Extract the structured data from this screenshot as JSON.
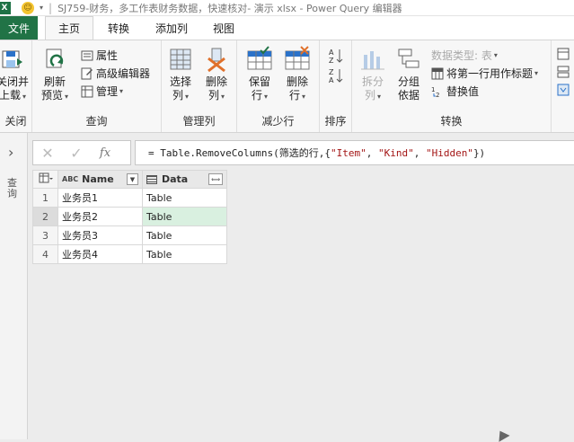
{
  "titlebar": {
    "app_icon": "X",
    "title": "SJ759-财务，多工作表财务数据，快速核对- 演示 xlsx - Power Query 编辑器"
  },
  "tabs": [
    {
      "label": "文件"
    },
    {
      "label": "主页"
    },
    {
      "label": "转换"
    },
    {
      "label": "添加列"
    },
    {
      "label": "视图"
    }
  ],
  "ribbon": {
    "close": {
      "btn_line1": "关闭并",
      "btn_line2": "上载",
      "group": "关闭"
    },
    "query": {
      "refresh_line1": "刷新",
      "refresh_line2": "预览",
      "properties": "属性",
      "advanced_editor": "高级编辑器",
      "manage": "管理",
      "group": "查询"
    },
    "manage_cols": {
      "choose_line1": "选择",
      "choose_line2": "列",
      "remove_line1": "删除",
      "remove_line2": "列",
      "group": "管理列"
    },
    "reduce_rows": {
      "keep_line1": "保留",
      "keep_line2": "行",
      "remove_line1": "删除",
      "remove_line2": "行",
      "group": "减少行"
    },
    "sort": {
      "group": "排序"
    },
    "transform": {
      "split_line1": "拆分",
      "split_line2": "列",
      "group_line1": "分组",
      "group_line2": "依据",
      "datatype": "数据类型: 表",
      "first_row_header": "将第一行用作标题",
      "replace_values": "替换值",
      "group": "转换"
    }
  },
  "leftnav": {
    "label": "查询"
  },
  "formula": {
    "prefix": "= Table.RemoveColumns(筛选的行,{",
    "s1": "\"Item\"",
    "comma1": ", ",
    "s2": "\"Kind\"",
    "comma2": ", ",
    "s3": "\"Hidden\"",
    "suffix": "})",
    "fx": "fx"
  },
  "table": {
    "columns": [
      {
        "name": "Name",
        "type": "ABC"
      },
      {
        "name": "Data",
        "type": "table"
      }
    ],
    "rows": [
      {
        "n": "1",
        "name": "业务员1",
        "data": "Table"
      },
      {
        "n": "2",
        "name": "业务员2",
        "data": "Table"
      },
      {
        "n": "3",
        "name": "业务员3",
        "data": "Table"
      },
      {
        "n": "4",
        "name": "业务员4",
        "data": "Table"
      }
    ]
  }
}
